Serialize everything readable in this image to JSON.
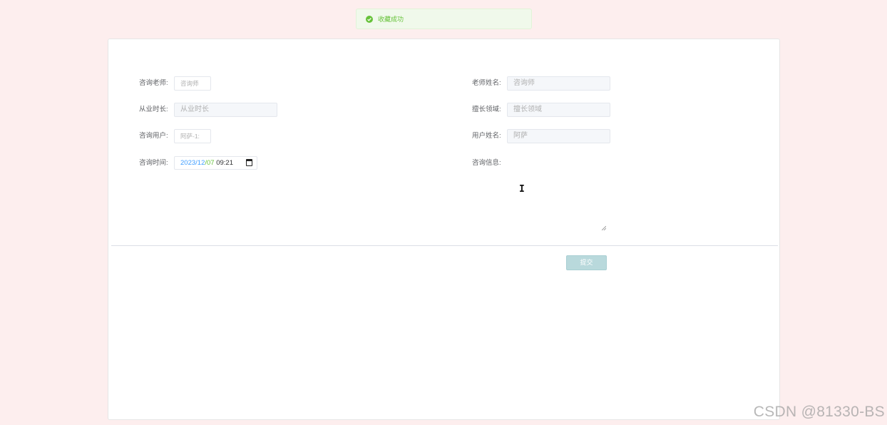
{
  "toast": {
    "icon": "check-circle-icon",
    "message": "收藏成功",
    "color": "#67c23a"
  },
  "form": {
    "left": [
      {
        "label": "咨询老师:",
        "value": "咨询师"
      },
      {
        "label": "从业时长:",
        "value": "从业时长"
      },
      {
        "label": "咨询用户:",
        "value": "阿萨-1:"
      },
      {
        "label": "咨询时间:"
      }
    ],
    "right": [
      {
        "label": "老师姓名:",
        "value": "咨询师"
      },
      {
        "label": "擅长领域:",
        "value": "擅长领域"
      },
      {
        "label": "用户姓名:",
        "value": "阿萨"
      },
      {
        "label": "咨询信息:"
      }
    ],
    "datetime": {
      "year": "2023",
      "month": "12",
      "day": "07",
      "time": "09:21",
      "icon": "calendar-icon"
    },
    "submit_label": "提交"
  },
  "watermark": "CSDN @81330-BS",
  "colors": {
    "background": "#fdeeee",
    "submit": "#b9d9dc",
    "accent_blue": "#409eff",
    "accent_green": "#67c23a"
  }
}
